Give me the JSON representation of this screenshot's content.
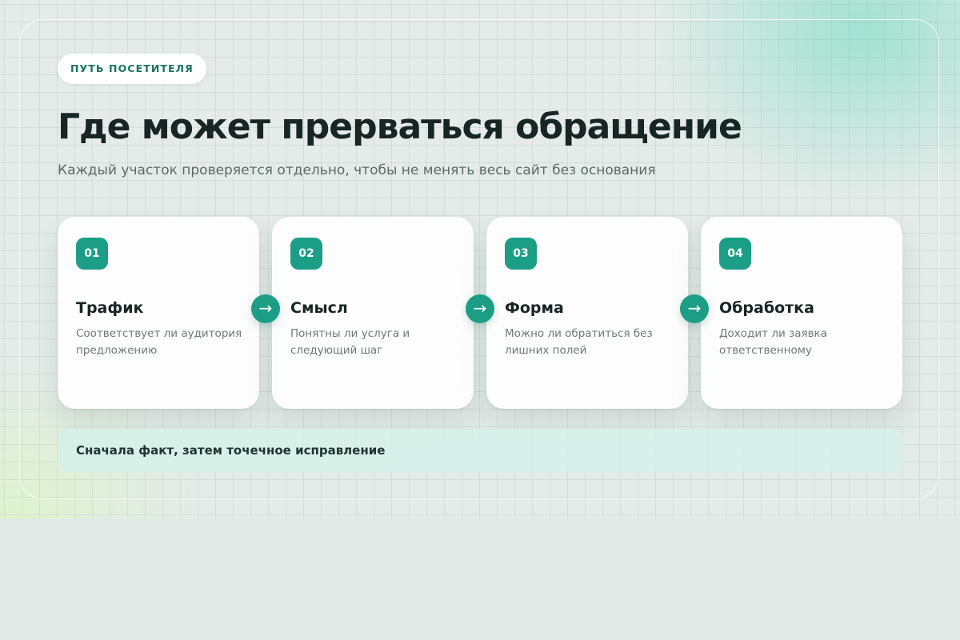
{
  "eyebrow": "ПУТЬ ПОСЕТИТЕЛЯ",
  "title": "Где может прерваться обращение",
  "subtitle": "Каждый участок проверяется отдельно, чтобы не менять весь сайт без основания",
  "steps": [
    {
      "number": "01",
      "title": "Трафик",
      "description": "Соответствует ли аудитория предложению"
    },
    {
      "number": "02",
      "title": "Смысл",
      "description": "Понятны ли услуга и следующий шаг"
    },
    {
      "number": "03",
      "title": "Форма",
      "description": "Можно ли обратиться без лишних полей"
    },
    {
      "number": "04",
      "title": "Обработка",
      "description": "Доходит ли заявка ответственному"
    }
  ],
  "arrow_symbol": "→",
  "note": "Сначала факт, затем точечное исправление",
  "colors": {
    "accent": "#1b9e85",
    "eyebrow_text": "#17735f",
    "heading": "#172623",
    "muted": "#5b6a67",
    "note_bg": "#d6f0e8",
    "page_bg": "#e3e9e7"
  }
}
